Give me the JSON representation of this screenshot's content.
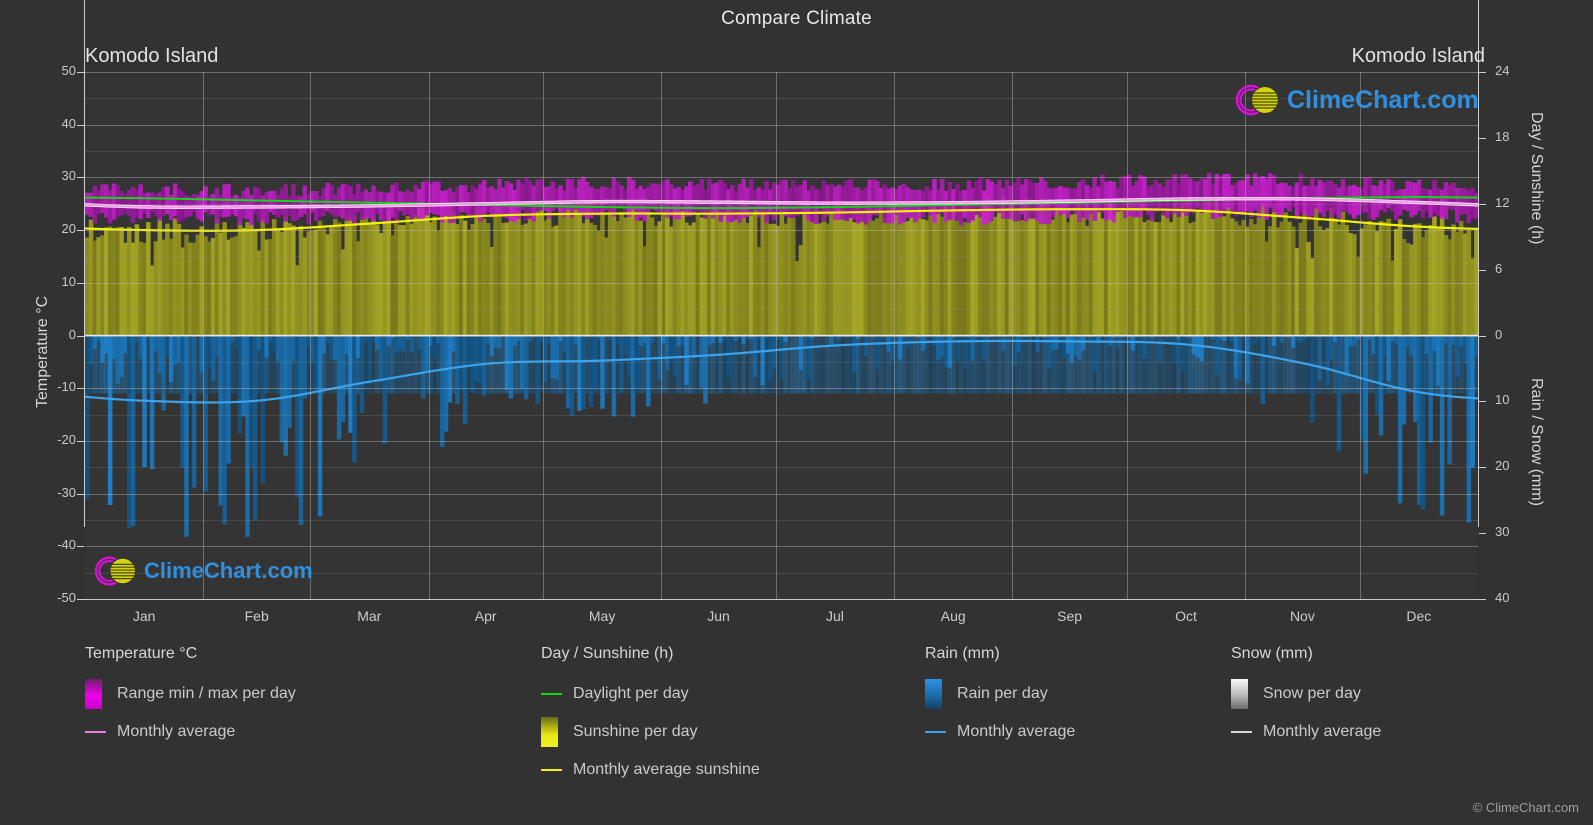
{
  "header": {
    "title": "Compare Climate"
  },
  "locations": {
    "left": "Komodo Island",
    "right": "Komodo Island"
  },
  "axes": {
    "temperature": {
      "label": "Temperature °C",
      "ticks": [
        "50",
        "40",
        "30",
        "20",
        "10",
        "0",
        "-10",
        "-20",
        "-30",
        "-40",
        "-50"
      ],
      "min": -50,
      "max": 50
    },
    "day_sunshine": {
      "label": "Day / Sunshine (h)",
      "ticks": [
        "24",
        "18",
        "12",
        "6",
        "0"
      ],
      "min": 0,
      "max": 24
    },
    "rain_snow": {
      "label": "Rain / Snow (mm)",
      "ticks": [
        "0",
        "10",
        "20",
        "30",
        "40"
      ],
      "min": 0,
      "max": 40
    },
    "months": [
      "Jan",
      "Feb",
      "Mar",
      "Apr",
      "May",
      "Jun",
      "Jul",
      "Aug",
      "Sep",
      "Oct",
      "Nov",
      "Dec"
    ]
  },
  "legend": {
    "groups": [
      {
        "title": "Temperature °C",
        "items": [
          {
            "label": "Range min / max per day",
            "swatch": "gradient-magenta",
            "type": "box",
            "color": "#e000e0"
          },
          {
            "label": "Monthly average",
            "swatch": "line-magenta",
            "type": "line",
            "color": "#e87fd8"
          }
        ]
      },
      {
        "title": "Day / Sunshine (h)",
        "items": [
          {
            "label": "Daylight per day",
            "swatch": "line-green",
            "type": "line",
            "color": "#12d812"
          },
          {
            "label": "Sunshine per day",
            "swatch": "gradient-yellow",
            "type": "box",
            "color": "#e8e814"
          },
          {
            "label": "Monthly average sunshine",
            "swatch": "line-yellow",
            "type": "line",
            "color": "#f2f20a"
          }
        ]
      },
      {
        "title": "Rain (mm)",
        "items": [
          {
            "label": "Rain per day",
            "swatch": "gradient-blue",
            "type": "box",
            "color": "#1782d8"
          },
          {
            "label": "Monthly average",
            "swatch": "line-blue",
            "type": "line",
            "color": "#3ba3ec"
          }
        ]
      },
      {
        "title": "Snow (mm)",
        "items": [
          {
            "label": "Snow per day",
            "swatch": "gradient-white",
            "type": "box",
            "color": "#f0f0f0"
          },
          {
            "label": "Monthly average",
            "swatch": "line-white",
            "type": "line",
            "color": "#d8d8d8"
          }
        ]
      }
    ]
  },
  "branding": {
    "logo_text": "ClimeChart.com",
    "copyright": "© ClimeChart.com"
  },
  "colors": {
    "background": "#323232",
    "plot_background": "#343434",
    "grid": "#bebebe",
    "temp_range": "#cc00cc",
    "temp_avg": "#ef9fe5",
    "daylight": "#12d812",
    "sunshine_fill": "#9a9a22",
    "sunshine_avg": "#f2f20a",
    "rain_fill": "#1a74b8",
    "rain_avg": "#3ba3ec",
    "logo_blue": "#2f8fe0",
    "logo_magenta": "#d810d8",
    "logo_yellow": "#d8d810"
  },
  "chart_data": {
    "type": "area",
    "title": "Compare Climate",
    "subtitle": "Komodo Island",
    "xlabel": "",
    "ylabel": "Temperature °C",
    "categories": [
      "Jan",
      "Feb",
      "Mar",
      "Apr",
      "May",
      "Jun",
      "Jul",
      "Aug",
      "Sep",
      "Oct",
      "Nov",
      "Dec"
    ],
    "axis_left": {
      "name": "Temperature °C",
      "min": -50,
      "max": 50,
      "ticks": [
        50,
        40,
        30,
        20,
        10,
        0,
        -10,
        -20,
        -30,
        -40,
        -50
      ]
    },
    "axis_right_top": {
      "name": "Day / Sunshine (h)",
      "min": 0,
      "max": 24,
      "ticks": [
        0,
        6,
        12,
        18,
        24
      ]
    },
    "axis_right_bottom": {
      "name": "Rain / Snow (mm)",
      "min": 0,
      "max": 40,
      "ticks": [
        0,
        10,
        20,
        30,
        40
      ],
      "inverted": true
    },
    "grid": true,
    "legend_position": "bottom",
    "series": [
      {
        "name": "Monthly average temperature",
        "unit": "°C",
        "axis": "left",
        "color": "#ef9fe5",
        "values": [
          24.4,
          24.4,
          24.6,
          25.0,
          25.4,
          25.3,
          25.1,
          25.2,
          25.5,
          25.9,
          25.9,
          25.2
        ]
      },
      {
        "name": "Temperature range max per day",
        "unit": "°C",
        "axis": "left",
        "color": "#cc00cc",
        "values": [
          27.5,
          27.4,
          27.8,
          28.4,
          28.7,
          28.5,
          28.3,
          28.5,
          29.0,
          29.4,
          29.3,
          28.3
        ]
      },
      {
        "name": "Temperature range min per day",
        "unit": "°C",
        "axis": "left",
        "color": "#cc00cc",
        "values": [
          22.4,
          22.3,
          22.5,
          22.9,
          23.1,
          22.8,
          22.4,
          22.3,
          22.6,
          23.1,
          23.4,
          23.0
        ]
      },
      {
        "name": "Daylight per day",
        "unit": "h",
        "axis": "right_top",
        "color": "#12d812",
        "values": [
          12.5,
          12.3,
          12.1,
          11.9,
          11.7,
          11.6,
          11.7,
          11.9,
          12.1,
          12.3,
          12.5,
          12.6
        ]
      },
      {
        "name": "Monthly average sunshine",
        "unit": "h",
        "axis": "right_top",
        "color": "#f2f20a",
        "values": [
          9.6,
          9.6,
          10.2,
          10.9,
          11.1,
          11.1,
          11.2,
          11.4,
          11.5,
          11.4,
          10.7,
          9.9
        ]
      },
      {
        "name": "Rain monthly average",
        "unit": "mm",
        "axis": "right_bottom",
        "color": "#3ba3ec",
        "values": [
          9.9,
          9.9,
          7.0,
          4.3,
          3.8,
          2.9,
          1.5,
          0.9,
          0.9,
          1.4,
          4.3,
          8.7
        ]
      },
      {
        "name": "Snow monthly average",
        "unit": "mm",
        "axis": "right_bottom",
        "color": "#d8d8d8",
        "values": [
          0,
          0,
          0,
          0,
          0,
          0,
          0,
          0,
          0,
          0,
          0,
          0
        ]
      }
    ]
  }
}
